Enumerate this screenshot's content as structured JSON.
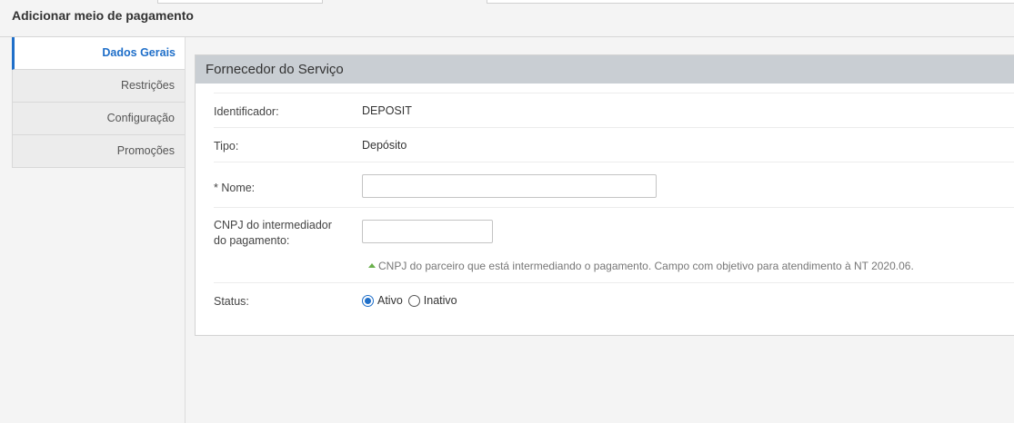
{
  "page": {
    "title": "Adicionar meio de pagamento"
  },
  "sidebar": {
    "items": [
      {
        "label": "Dados Gerais",
        "active": true
      },
      {
        "label": "Restrições",
        "active": false
      },
      {
        "label": "Configuração",
        "active": false
      },
      {
        "label": "Promoções",
        "active": false
      }
    ]
  },
  "panel": {
    "title": "Fornecedor do Serviço",
    "fields": {
      "identificador": {
        "label": "Identificador:",
        "value": "DEPOSIT"
      },
      "tipo": {
        "label": "Tipo:",
        "value": "Depósito"
      },
      "nome": {
        "label": "* Nome:",
        "value": ""
      },
      "cnpj": {
        "label_line1": "CNPJ do intermediador",
        "label_line2": "do pagamento:",
        "value": "",
        "hint": "CNPJ do parceiro que está intermediando o pagamento. Campo com objetivo para atendimento à NT 2020.06."
      },
      "status": {
        "label": "Status:",
        "options": [
          {
            "label": "Ativo",
            "checked": true
          },
          {
            "label": "Inativo",
            "checked": false
          }
        ]
      }
    }
  },
  "colors": {
    "accent": "#1f6fc9",
    "hint_arrow": "#6ab04c",
    "panel_header": "#c9ced3"
  }
}
